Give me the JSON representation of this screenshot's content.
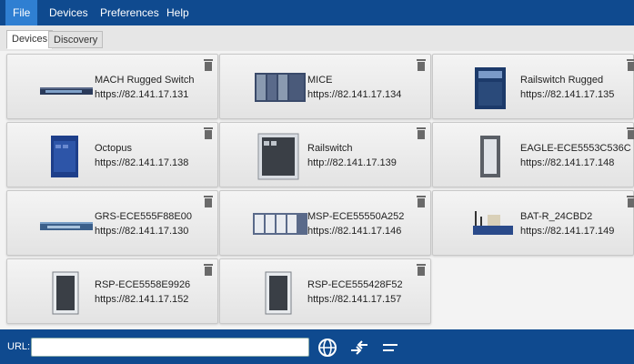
{
  "menu": [
    "File",
    "Devices",
    "Preferences",
    "Help"
  ],
  "tabs": [
    "Devices",
    "Discovery"
  ],
  "devices": [
    {
      "name": "MACH Rugged Switch",
      "url": "https://82.141.17.131"
    },
    {
      "name": "MICE",
      "url": "https://82.141.17.134"
    },
    {
      "name": "Railswitch Rugged",
      "url": "https://82.141.17.135"
    },
    {
      "name": "Octopus",
      "url": "https://82.141.17.138"
    },
    {
      "name": "Railswitch",
      "url": "http://82.141.17.139"
    },
    {
      "name": "EAGLE-ECE5553C536C",
      "url": "https://82.141.17.148"
    },
    {
      "name": "GRS-ECE555F88E00",
      "url": "https://82.141.17.130"
    },
    {
      "name": "MSP-ECE55550A252",
      "url": "https://82.141.17.146"
    },
    {
      "name": "BAT-R_24CBD2",
      "url": "https://82.141.17.149"
    },
    {
      "name": "RSP-ECE5558E9926",
      "url": "https://82.141.17.152"
    },
    {
      "name": "RSP-ECE555428F52",
      "url": "https://82.141.17.157"
    }
  ],
  "bottom": {
    "url_label": "URL:",
    "url_value": ""
  },
  "icons": {
    "trash": "trash-icon",
    "globe": "globe-icon",
    "transfer": "transfer-arrows-icon",
    "menu": "menu-lines-icon"
  },
  "colors": {
    "bar": "#0f4a8f",
    "active_menu": "#2f7fd2"
  }
}
